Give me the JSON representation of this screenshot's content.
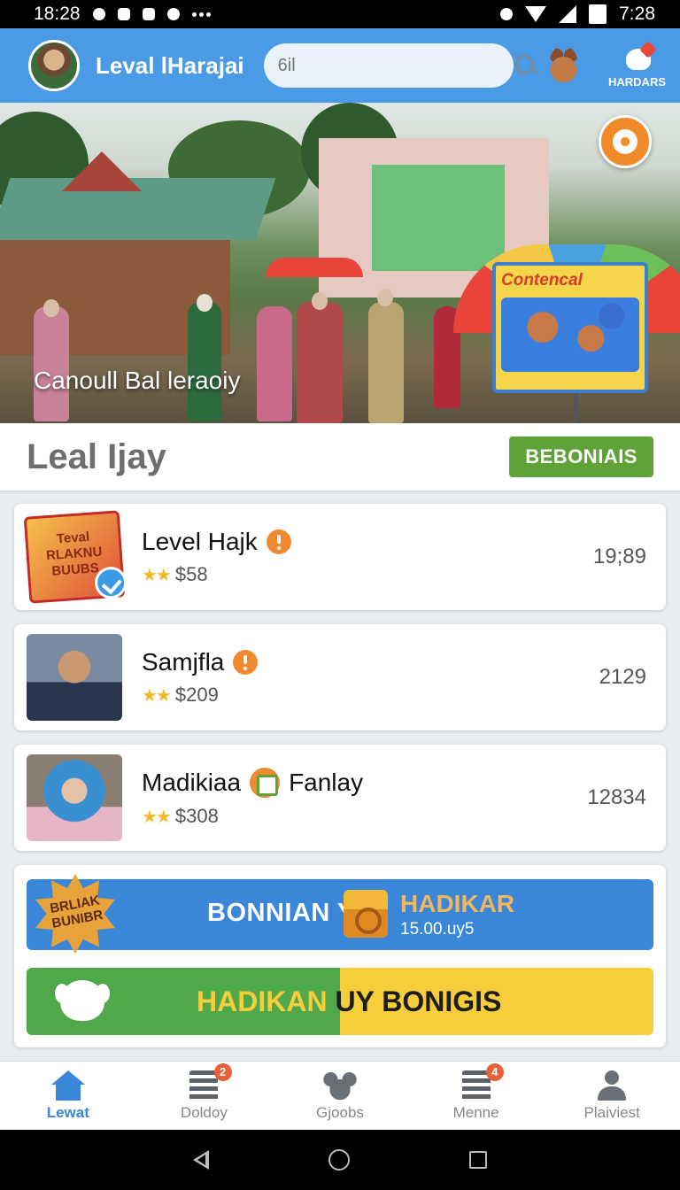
{
  "status_bar": {
    "time_left": "18:28",
    "time_right": "7:28"
  },
  "header": {
    "title": "Leval lHarajai",
    "search_placeholder": "6il",
    "rewards_label": "HARDARS"
  },
  "hero": {
    "caption": "Canoull Bal leraoiy",
    "poster_title": "Contencal"
  },
  "section": {
    "title": "Leal Ijay",
    "button_label": "BEBONIAIS"
  },
  "cards": [
    {
      "name": "Level Hajk",
      "price": "$58",
      "count": "19;89",
      "badge_text": "Teval RLAKNU BUUBS"
    },
    {
      "name": "Samjfla",
      "price": "$209",
      "count": "2129"
    },
    {
      "name": "Madikiaa",
      "extra": "Fanlay",
      "price": "$308",
      "count": "12834"
    }
  ],
  "promo": {
    "burst_text": "BRLIAK BUNIBR",
    "main_text": "BONNIAN Y",
    "side_title": "HADIKAR",
    "side_sub": "15.00.uy5",
    "bar_text_a": "HADIKAN ",
    "bar_text_b": "UY BONIGIS"
  },
  "nav": [
    {
      "label": "Lewat",
      "badge": ""
    },
    {
      "label": "Doldoy",
      "badge": "2"
    },
    {
      "label": "Gjoobs",
      "badge": ""
    },
    {
      "label": "Menne",
      "badge": "4"
    },
    {
      "label": "Plaiviest",
      "badge": ""
    }
  ],
  "colors": {
    "header_blue": "#4a9ae6",
    "accent_green": "#5da338",
    "accent_orange": "#ef8a30",
    "nav_active": "#3a86d8",
    "star_gold": "#f2b82a"
  }
}
